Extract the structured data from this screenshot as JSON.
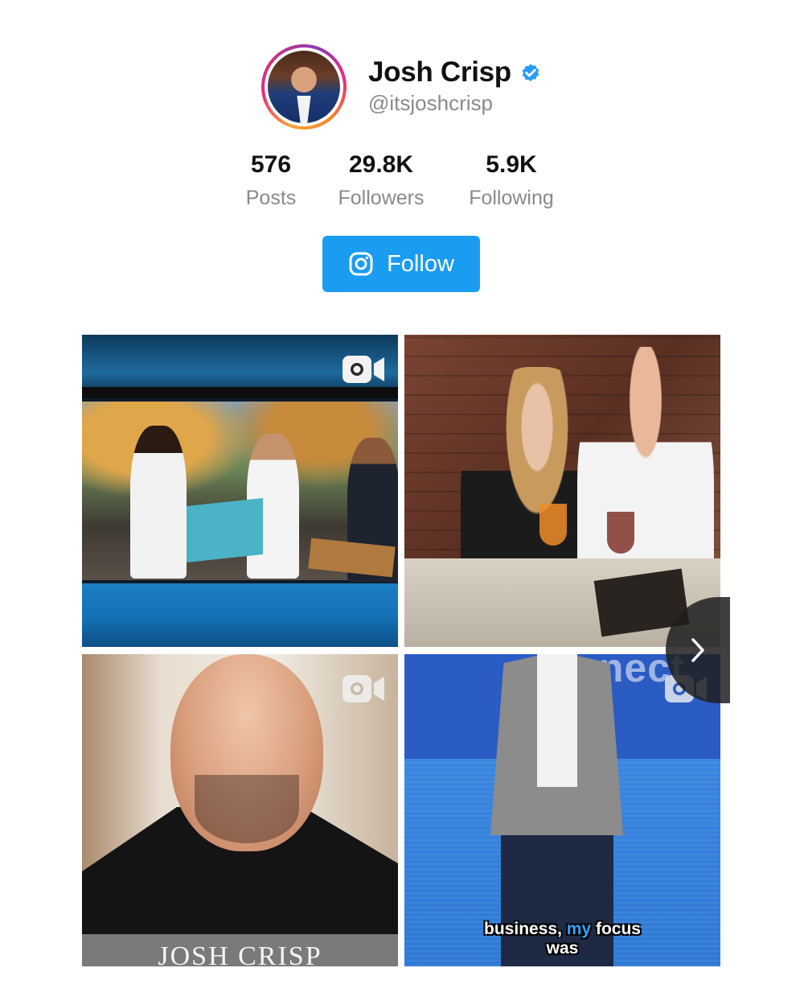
{
  "profile": {
    "display_name": "Josh Crisp",
    "verified": true,
    "handle": "@itsjoshcrisp",
    "avatar_icon": "profile-photo"
  },
  "stats": [
    {
      "value": "576",
      "label": "Posts"
    },
    {
      "value": "29.8K",
      "label": "Followers"
    },
    {
      "value": "5.9K",
      "label": "Following"
    }
  ],
  "follow_button": {
    "label": "Follow",
    "icon": "instagram-icon",
    "color": "#1a9cf0"
  },
  "grid": {
    "tiles": [
      {
        "type": "video",
        "icon": "video-icon"
      },
      {
        "type": "photo"
      },
      {
        "type": "video",
        "icon": "video-icon",
        "caption": "JOSH CRISP"
      },
      {
        "type": "video",
        "icon": "video-icon",
        "caption_line1_a": "business,",
        "caption_line1_highlight": "my",
        "caption_line1_b": "focus",
        "caption_line2": "was",
        "screen_text": "connect"
      }
    ],
    "next_icon": "chevron-right-icon"
  },
  "colors": {
    "verified_badge": "#2b9cf5",
    "muted_text": "#8a8a8a"
  }
}
